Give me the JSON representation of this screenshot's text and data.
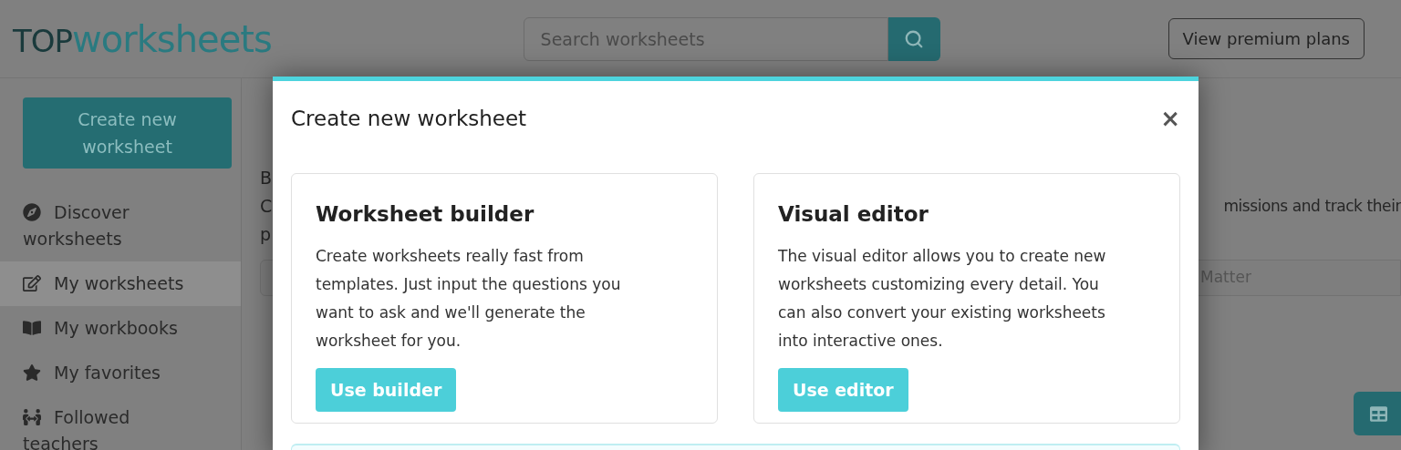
{
  "header": {
    "logo": {
      "dark_part": "TOP",
      "teal_part": "worksheets"
    },
    "search": {
      "placeholder": "Search worksheets"
    },
    "premium_button": "View premium plans"
  },
  "sidebar": {
    "create_button": "Create new worksheet",
    "items": [
      {
        "label": "Discover worksheets",
        "kind": "compass",
        "selected": false
      },
      {
        "label": "My worksheets",
        "kind": "edit",
        "selected": true
      },
      {
        "label": "My workbooks",
        "kind": "book",
        "selected": false
      },
      {
        "label": "My favorites",
        "kind": "star",
        "selected": false
      },
      {
        "label": "Followed teachers",
        "kind": "people",
        "selected": false
      }
    ]
  },
  "page": {
    "left_fragments": [
      "B",
      "C",
      "p"
    ],
    "right_fragment": "missions and track their",
    "filter_fragment": "Matter"
  },
  "modal": {
    "title": "Create new worksheet",
    "close": "×",
    "cards": [
      {
        "title": "Worksheet builder",
        "text": "Create worksheets really fast from templates. Just input the questions you want to ask and we'll generate the worksheet for you.",
        "button": "Use builder"
      },
      {
        "title": "Visual editor",
        "text": "The visual editor allows you to create new worksheets customizing every detail. You can also convert your existing worksheets into interactive ones.",
        "button": "Use editor"
      }
    ]
  }
}
